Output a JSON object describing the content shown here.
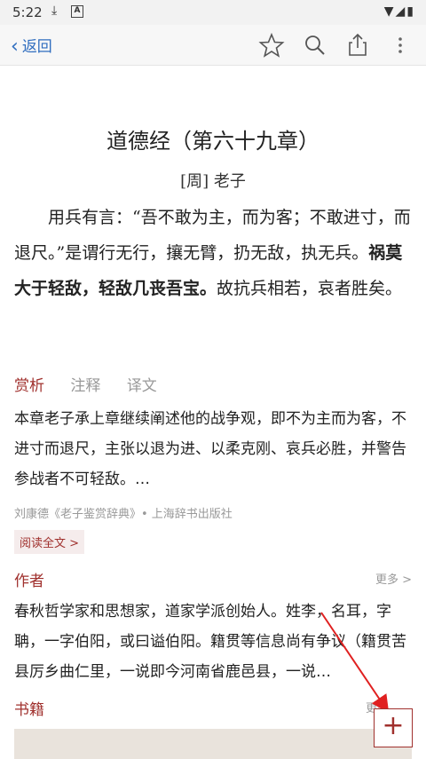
{
  "status_bar": {
    "time": "5:22"
  },
  "nav": {
    "back_label": "返回"
  },
  "poem": {
    "title": "道德经（第六十九章）",
    "author": "[周] 老子",
    "text_a": "用兵有言：“吾不敢为主，而为客；不敢进寸，而退尺。”是谓行无行，攘无臂，扔无敌，执无兵。",
    "text_bold": "祸莫大于轻敌，轻敌几丧吾宝。",
    "text_b": "故抗兵相若，哀者胜矣。"
  },
  "tabs": [
    {
      "label": "赏析"
    },
    {
      "label": "注释"
    },
    {
      "label": "译文"
    }
  ],
  "appreciation": {
    "text": "本章老子承上章继续阐述他的战争观，即不为主而为客，不进寸而退尺，主张以退为进、以柔克刚、哀兵必胜，并警告参战者不可轻敌。…",
    "source": "刘康德《老子鉴赏辞典》• 上海辞书出版社",
    "read_all": "阅读全文 >"
  },
  "author_section": {
    "title": "作者",
    "more": "更多 >",
    "text": "春秋哲学家和思想家，道家学派创始人。姓李，名耳，字聃，一字伯阳，或曰谥伯阳。籍贯等信息尚有争议（籍贯苦县厉乡曲仁里，一说即今河南省鹿邑县，一说…"
  },
  "books_section": {
    "title": "书籍",
    "more": "更多"
  },
  "fab": {
    "label": "+"
  },
  "colors": {
    "accent": "#a0302d",
    "link": "#2f6dbf",
    "arrow": "#e02020"
  }
}
